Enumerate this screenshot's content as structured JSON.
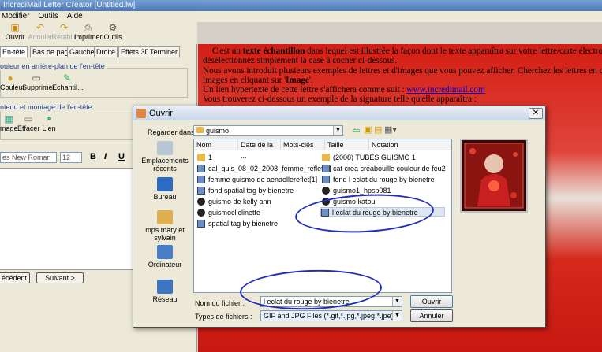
{
  "app": {
    "title": "IncrediMail Letter Creator [Untitled.lw]",
    "menu": [
      "Modifier",
      "Outils",
      "Aide"
    ],
    "toolbar": [
      "Ouvrir",
      "Annuler",
      "Rétablir",
      "Imprimer",
      "Outils"
    ]
  },
  "left_panel": {
    "tabs": [
      "En-tête",
      "Bas de page",
      "Gauche",
      "Droite",
      "Effets 3D",
      "Terminer"
    ],
    "group1_title": "ouleur en arrière-plan de l'en-tête",
    "group1_buttons": [
      "Couleur",
      "Supprimer",
      "Echantil..."
    ],
    "group2_title": "ntenu et montage de l'en-tête",
    "group2_buttons": [
      "mage",
      "Effacer",
      "Lien"
    ],
    "font_name": "es New Roman",
    "font_size": "12",
    "format_buttons": [
      "B",
      "I",
      "U"
    ],
    "prev_label": "écédent",
    "next_label": "Suivant >"
  },
  "page": {
    "lines": [
      {
        "pre": "C'est un ",
        "bold": "texte échantillon",
        "post": " dans lequel est illustrée la façon dont le texte apparaîtra sur votre lettre/carte électroni"
      },
      {
        "pre": "désélectionnez simplement la case à cocher ci-dessous.",
        "bold": "",
        "post": ""
      },
      {
        "pre": "Nous avons introduit plusieurs exemples de lettres et d'images que vous pouvez afficher. Cherchez les lettres en cli",
        "bold": "",
        "post": ""
      },
      {
        "pre": "images en cliquant sur '",
        "bold": "Image",
        "post": "'."
      },
      {
        "pre": "Un lien hypertexte de cette lettre s'affichera comme suit : ",
        "bold": "",
        "post": "",
        "link": "www.incredimail.com"
      },
      {
        "pre": "Vous trouverez ci-dessous un exemple de la signature telle qu'elle apparaîtra :",
        "bold": "",
        "post": ""
      }
    ]
  },
  "dialog": {
    "title": "Ouvrir",
    "look_in_label": "Regarder dans :",
    "look_in_value": "guismo",
    "places": [
      "Emplacements récents",
      "Bureau",
      "mps mary et sylvain",
      "Ordinateur",
      "Réseau"
    ],
    "columns": [
      "Nom",
      "Date de la ...",
      "Mots-clés",
      "Taille",
      "Notation"
    ],
    "files_left": [
      {
        "name": "1",
        "kind": "folder"
      },
      {
        "name": "cal_guis_08_02_2008_femme_reflet[1]",
        "kind": "img"
      },
      {
        "name": "femme guismo de aenaellereflet[1]",
        "kind": "img"
      },
      {
        "name": "fond spatial tag by bienetre",
        "kind": "img"
      },
      {
        "name": "guismo de kelly ann",
        "kind": "dark"
      },
      {
        "name": "guismocliclinette",
        "kind": "dark"
      },
      {
        "name": "spatial tag by bienetre",
        "kind": "img"
      }
    ],
    "files_right": [
      {
        "name": "(2008) TUBES GUISMO 1",
        "kind": "folder"
      },
      {
        "name": "cat crea créabouille couleur de feu2",
        "kind": "img"
      },
      {
        "name": "fond l eclat du rouge by bienetre",
        "kind": "img"
      },
      {
        "name": "guismo1_hpsp081",
        "kind": "dark"
      },
      {
        "name": "guismo katou",
        "kind": "dark"
      },
      {
        "name": "l eclat du rouge by bienetre",
        "kind": "img",
        "selected": true
      }
    ],
    "filename_label": "Nom du fichier :",
    "filename_value": "l eclat du rouge by bienetre",
    "filetype_label": "Types de fichiers :",
    "filetype_value": "GIF and JPG Files (*.gif,*.jpg,*.jpeg,*.jpe)",
    "open_label": "Ouvrir",
    "cancel_label": "Annuler"
  },
  "colors": {
    "page_red": "#d41e14",
    "annotation_blue": "#1f2dbd"
  }
}
